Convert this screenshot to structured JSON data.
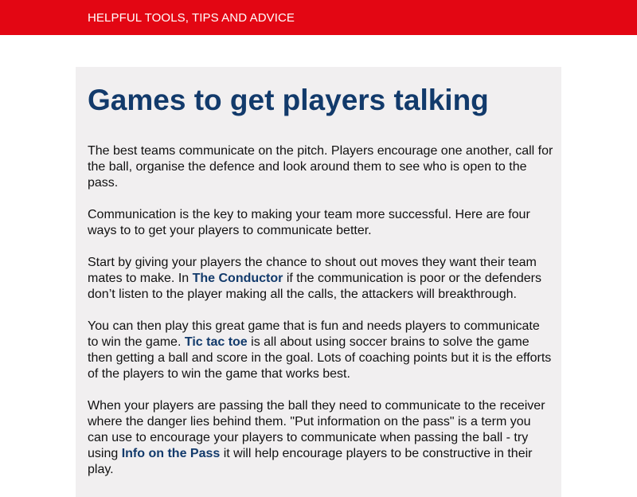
{
  "header": {
    "tagline": "HELPFUL TOOLS, TIPS AND ADVICE"
  },
  "article": {
    "title": "Games to get players talking",
    "p1": "The best teams communicate on the pitch. Players encourage one another, call for the ball, organise the defence and look around them to see who is open to the pass.",
    "p2": "Communication is the key to making your team more successful. Here are four ways to to get your players to communicate better.",
    "p3": {
      "before": "Start by giving your players the chance to shout out moves they want their team mates to make. In ",
      "link": "The Conductor",
      "after": " if the communication is poor or the defenders don’t listen to the player making all the calls, the attackers will breakthrough."
    },
    "p4": {
      "before": "You can then play this great game that is fun and needs players to communicate to win the game. ",
      "link": "Tic tac toe",
      "after": " is  all about using soccer brains to solve the game then getting a ball and score in the goal. Lots of coaching points but it is the efforts of the players to win the game that works best."
    },
    "p5": {
      "before": "When your players are passing the ball they need to communicate to the receiver where the danger lies behind them. \"Put information on the pass\" is a term you can use to encourage your players to communicate when passing the ball - try using ",
      "link": "Info on the Pass",
      "after": " it will help encourage players to be constructive in their play."
    }
  },
  "colors": {
    "brand_red": "#e30613",
    "title_blue": "#123a6b",
    "card_bg": "#f1eff0"
  }
}
